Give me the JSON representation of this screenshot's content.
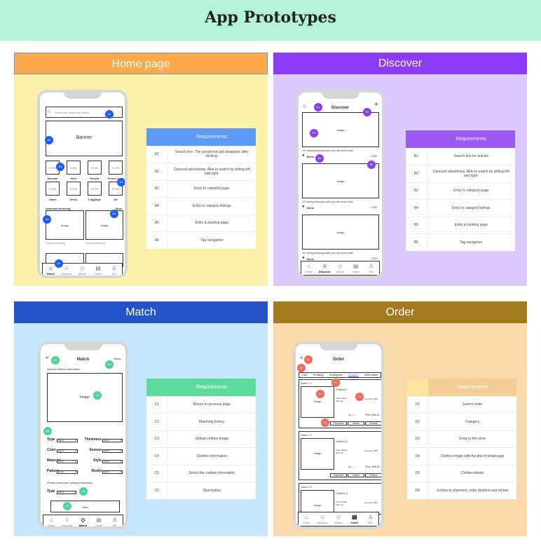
{
  "header": {
    "title": "App Prototypes"
  },
  "colors": {
    "home": "#fdaa4a",
    "discover": "#8c3cf5",
    "match": "#2253c7",
    "order": "#a47a1f"
  },
  "nav": [
    "Home",
    "Discover",
    "Match",
    "Order",
    "Me"
  ],
  "nav_icons": [
    "home-icon",
    "discover-icon",
    "match-icon",
    "order-icon",
    "me-icon"
  ],
  "home": {
    "title": "Home page",
    "search_placeholder": "Search for matching clothes",
    "banner": "Banner",
    "icon_label": "ICON",
    "categories": [
      "Sweater",
      "Shirt",
      "Hoodie",
      "Trench coat",
      "Jeans",
      "Dress",
      "Leggings",
      "All"
    ],
    "section_title": "Seasonal dressing",
    "more": "More",
    "image": "Image",
    "caption": "Spring dressing",
    "badges": [
      "A1",
      "A2",
      "A3",
      "A4",
      "A5",
      "A6",
      "A7"
    ],
    "table": {
      "header": "Requirements",
      "rows": [
        [
          "A1",
          "Search box. The preset text will disappear after clicking."
        ],
        [
          "A2",
          "Carousel advertising. Able to switch by sliding left and right."
        ],
        [
          "A3",
          "Entry to category page"
        ],
        [
          "A4",
          "Entry to category listings"
        ],
        [
          "A5",
          "Entry to landing page"
        ],
        [
          "A6",
          "Tag navigation"
        ]
      ]
    }
  },
  "discover": {
    "title": "Discover",
    "screen_title": "Discover",
    "image": "Image",
    "caption": "10+ spring dressing codes you can never miss!",
    "author": "Boris",
    "likes": "2333",
    "badges": [
      "B1",
      "B2",
      "B3",
      "B4",
      "B5"
    ],
    "table": {
      "header": "Requirements",
      "rows": [
        [
          "B1",
          "Search box for articles"
        ],
        [
          "B2",
          "Carousel advertising. Able to switch by sliding left and right."
        ],
        [
          "B3",
          "Entry to category page"
        ],
        [
          "B4",
          "Entry to category listings"
        ],
        [
          "B5",
          "Entry to landing page"
        ],
        [
          "B6",
          "Tag navigation"
        ]
      ]
    }
  },
  "match": {
    "title": "Match",
    "screen_title": "Match",
    "history": "History",
    "upload": "Upload clothes information",
    "image": "Image",
    "fields_left": [
      "Type",
      "Color",
      "Material",
      "Pattern"
    ],
    "fields_right": [
      "Thickness",
      "Season",
      "Style",
      "Model"
    ],
    "select": "Select",
    "prompt": "Please select the clothes information",
    "type": "Type",
    "start": "Start",
    "badges": [
      "C1",
      "C2",
      "C3",
      "C4",
      "C5",
      "C6"
    ],
    "table": {
      "header": "Requirements",
      "rows": [
        [
          "C1",
          "Return to previous page"
        ],
        [
          "C2",
          "Matching history"
        ],
        [
          "C3",
          "Upload clothes image"
        ],
        [
          "C4",
          "Clothes information"
        ],
        [
          "C5",
          "Select the clothes information"
        ],
        [
          "C6",
          "Start button"
        ]
      ]
    }
  },
  "order": {
    "title": "Order",
    "screen_title": "Order",
    "tabs": [
      "Cart",
      "Pending",
      "Unshipped",
      "Shipped",
      "After-sales"
    ],
    "active_tab": "Shipped",
    "stores": [
      {
        "store": "Store 1 >",
        "name": "Clothes 1",
        "color": "Color: black",
        "size": "Size: XL",
        "list_price": "List price: $55",
        "qty": "Qty: 1",
        "price": "Price: $55.00"
      },
      {
        "store": "Store 2 >",
        "name": "Clothes 2",
        "color": "Color: black",
        "size": "Size: XL",
        "list_price": "List price: $55",
        "qty": "Qty: 1",
        "price": "Price: $55.00"
      },
      {
        "store": "Store 3 >",
        "name": "Clothes 3",
        "color": "Color: khaki",
        "size": "Size: XL",
        "list_price": "List price: $55"
      }
    ],
    "image": "Image",
    "buttons": [
      "Shipment",
      "Delete",
      "Review"
    ],
    "badges": [
      "D1",
      "D2",
      "D3",
      "D4",
      "D5",
      "D6"
    ],
    "table": {
      "header": "Requirements",
      "rows": [
        [
          "D1",
          "Search order"
        ],
        [
          "D2",
          "Category"
        ],
        [
          "D3",
          "Entry to the store"
        ],
        [
          "D4",
          "Clothes image with the link of detail page"
        ],
        [
          "D5",
          "Clothes details"
        ],
        [
          "D6",
          "Entries to shipment, order deletion and review"
        ]
      ]
    }
  }
}
